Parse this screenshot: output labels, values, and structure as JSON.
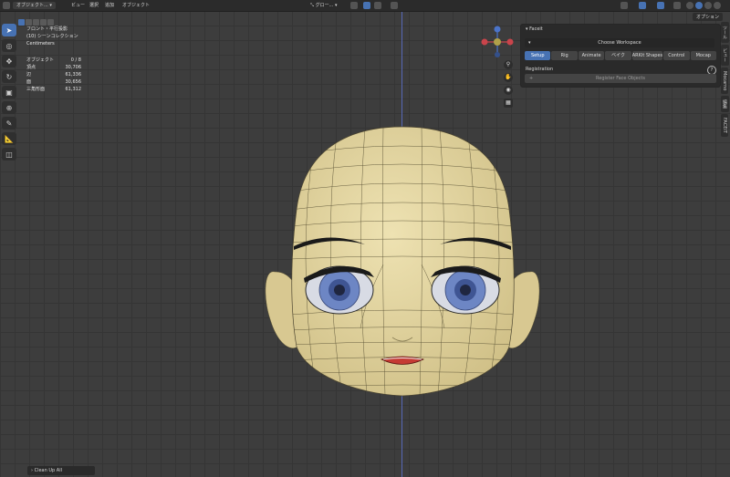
{
  "header": {
    "mode": "オブジェクト...",
    "menus": [
      "ビュー",
      "選択",
      "追加",
      "オブジェクト"
    ],
    "orientation": "グロー...",
    "options_label": "オプション"
  },
  "overlay": {
    "view_name": "フロント・平行投影",
    "collection": "(10) シーンコレクション",
    "units": "Centimeters"
  },
  "stats": [
    {
      "label": "オブジェクト",
      "value": "0 / 8"
    },
    {
      "label": "頂点",
      "value": "30,706"
    },
    {
      "label": "辺",
      "value": "61,336"
    },
    {
      "label": "面",
      "value": "30,656"
    },
    {
      "label": "三角形面",
      "value": "61,312"
    }
  ],
  "panel": {
    "title": "Faceit",
    "choose_workspace": "Choose Workspace",
    "tabs": [
      "Setup",
      "Rig",
      "Animate",
      "ベイク",
      "ARKit Shapes",
      "Control",
      "Mocap"
    ],
    "selected_tab": "Setup",
    "registration_label": "Registration",
    "register_button": "Register Face Objects"
  },
  "side_tabs": [
    "ツール",
    "ビュー",
    "Mocarno",
    "編集",
    "FACEIT"
  ],
  "operator_footer": "Clean Up All",
  "colors": {
    "accent": "#4772b3",
    "skin": "#e2d5a1",
    "iris": "#6d86c4",
    "lips": "#c53a33"
  }
}
